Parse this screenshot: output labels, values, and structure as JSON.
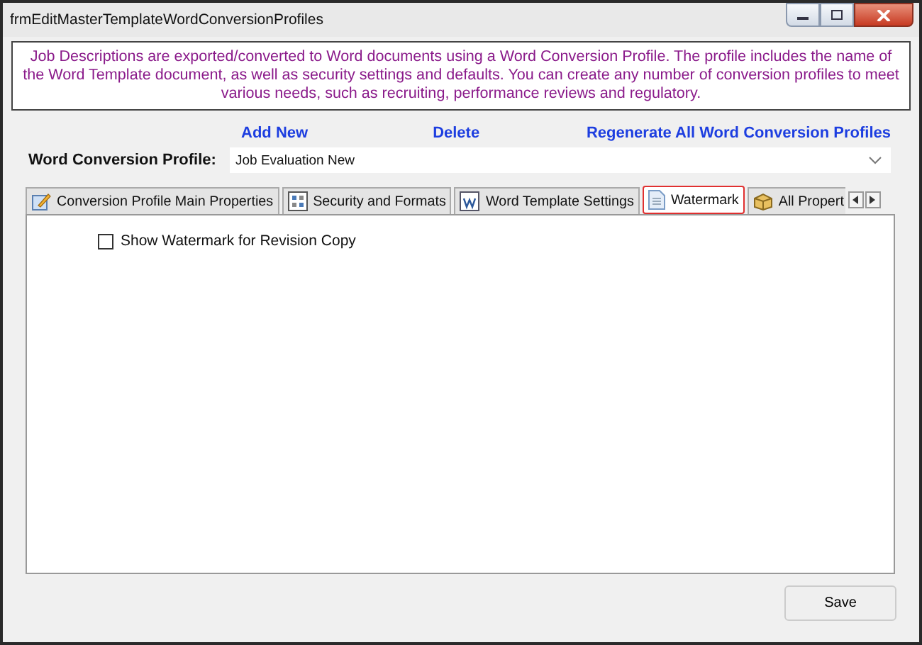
{
  "window": {
    "title": "frmEditMasterTemplateWordConversionProfiles"
  },
  "description": "Job Descriptions are exported/converted to Word documents using a Word Conversion Profile. The profile includes the name of the Word Template document, as well as security settings and defaults.  You can create any number of conversion profiles to meet various needs, such as recruiting, performance reviews and regulatory.",
  "links": [
    "Add New",
    "Delete",
    "Regenerate All Word Conversion Profiles"
  ],
  "profile": {
    "label": "Word Conversion Profile:",
    "value": "Job Evaluation New"
  },
  "tabs": [
    {
      "label": "Conversion Profile Main Properties",
      "kind": "edit",
      "selected": false
    },
    {
      "label": "Security and Formats",
      "kind": "grid",
      "selected": false
    },
    {
      "label": "Word Template Settings",
      "kind": "word",
      "selected": false
    },
    {
      "label": "Watermark",
      "kind": "page",
      "selected": true
    },
    {
      "label": "All Propert",
      "kind": "box",
      "selected": false
    }
  ],
  "options": [
    {
      "label": "Show Watermark for Revision Copy",
      "checked": false
    }
  ],
  "buttons": [
    "Save"
  ]
}
